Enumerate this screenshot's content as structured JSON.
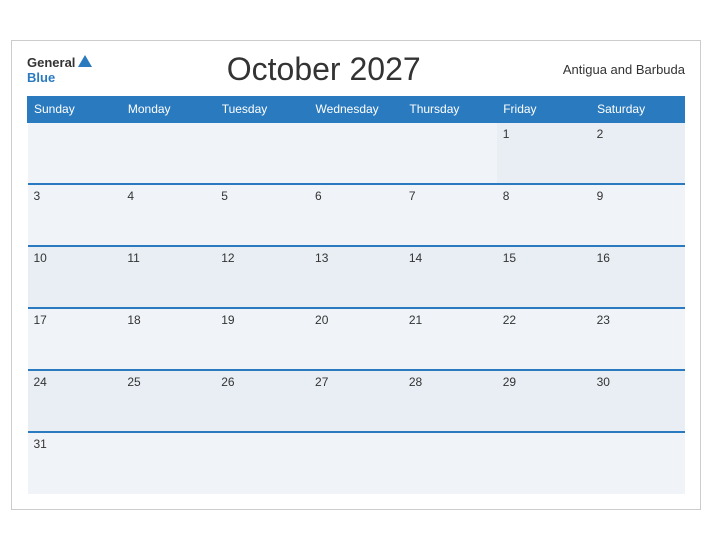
{
  "header": {
    "logo_general": "General",
    "logo_blue": "Blue",
    "month_title": "October 2027",
    "country": "Antigua and Barbuda"
  },
  "weekdays": [
    "Sunday",
    "Monday",
    "Tuesday",
    "Wednesday",
    "Thursday",
    "Friday",
    "Saturday"
  ],
  "weeks": [
    [
      null,
      null,
      null,
      null,
      null,
      1,
      2
    ],
    [
      3,
      4,
      5,
      6,
      7,
      8,
      9
    ],
    [
      10,
      11,
      12,
      13,
      14,
      15,
      16
    ],
    [
      17,
      18,
      19,
      20,
      21,
      22,
      23
    ],
    [
      24,
      25,
      26,
      27,
      28,
      29,
      30
    ],
    [
      31,
      null,
      null,
      null,
      null,
      null,
      null
    ]
  ]
}
